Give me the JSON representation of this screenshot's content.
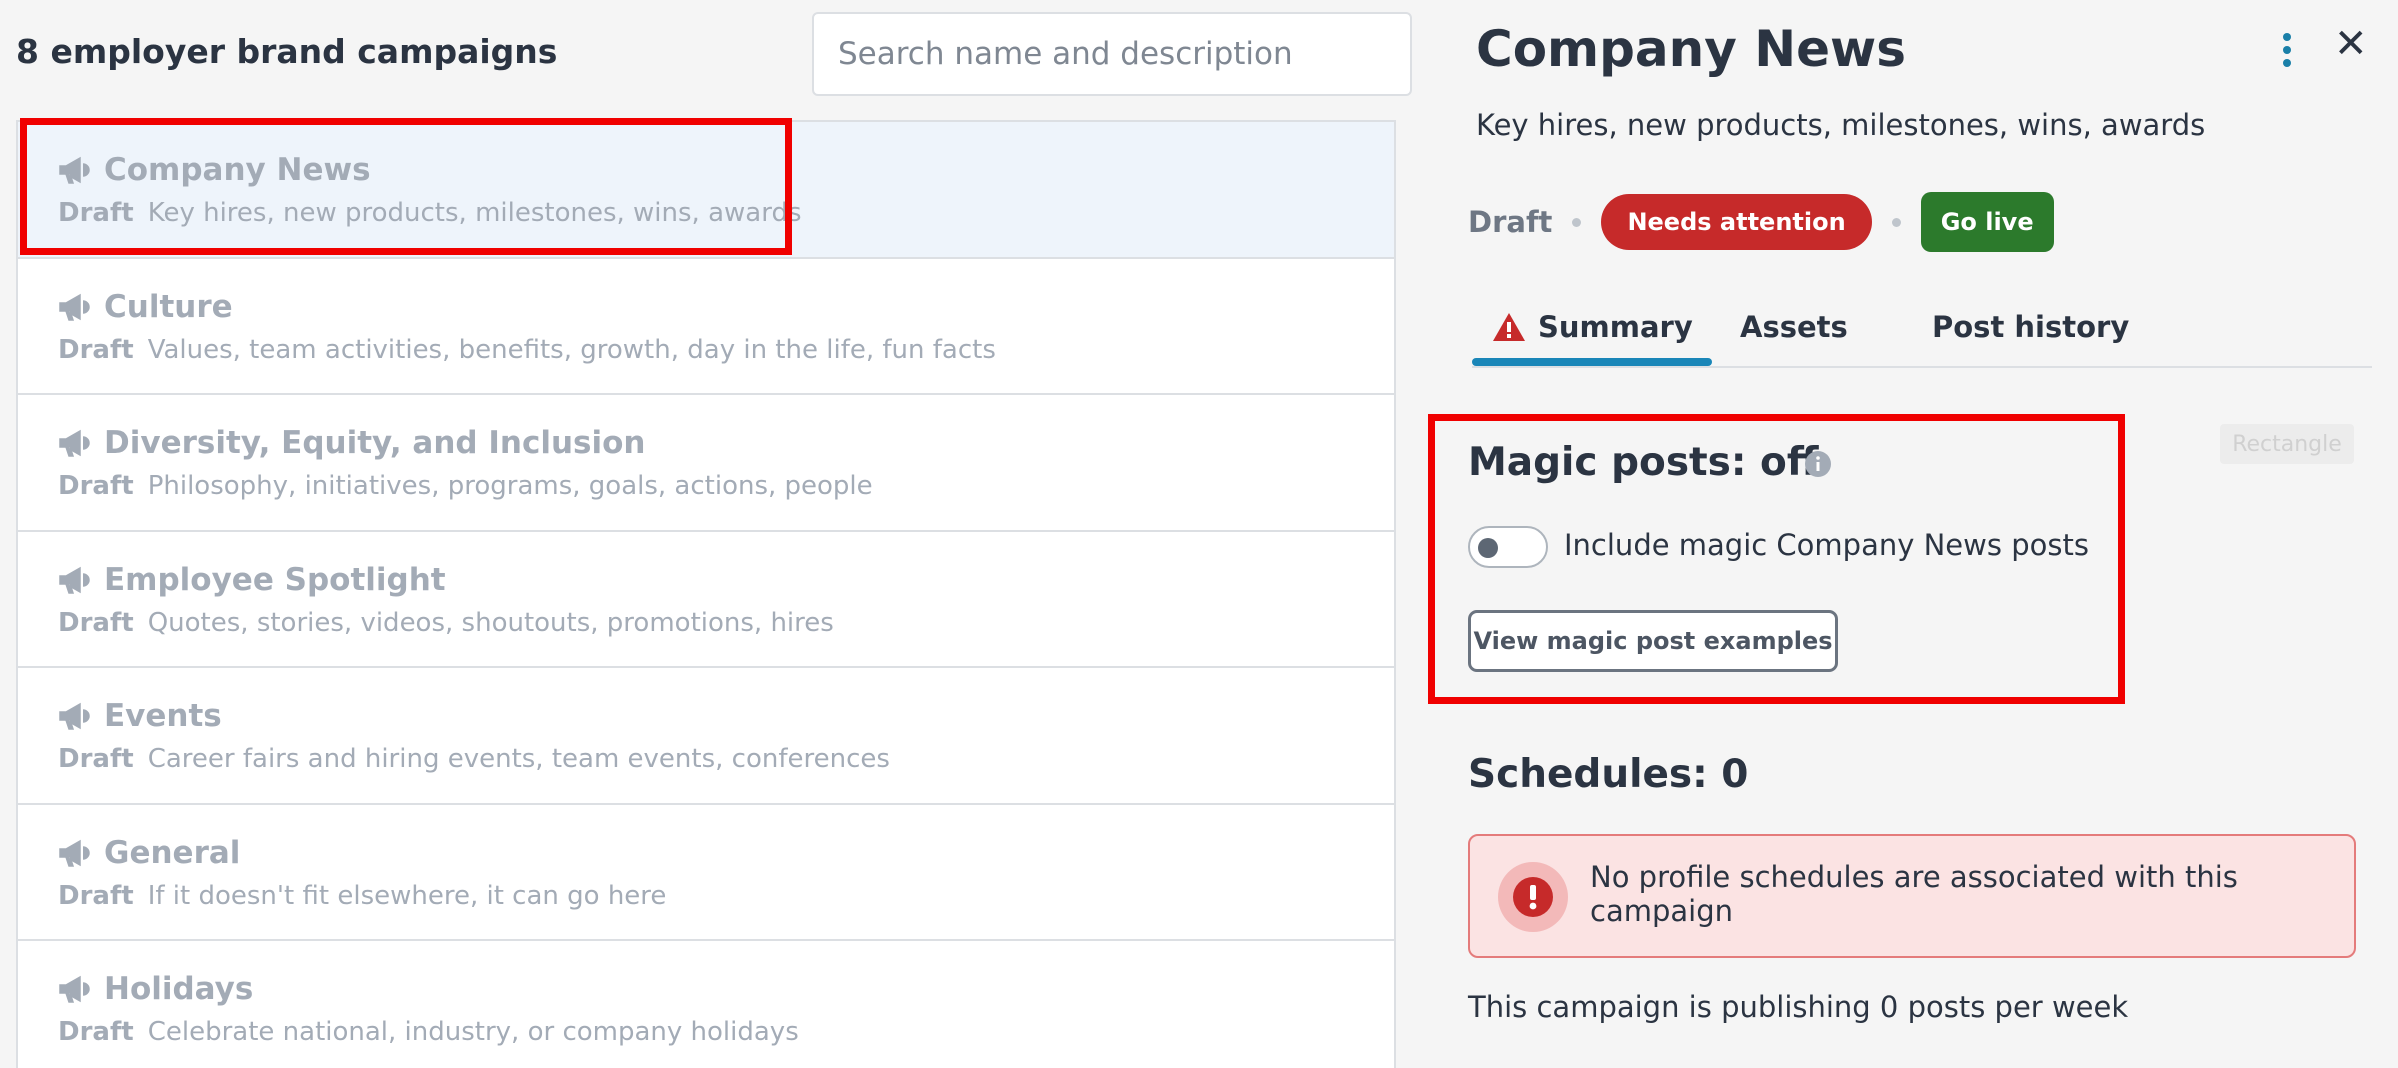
{
  "list": {
    "title": "8 employer brand campaigns",
    "search_placeholder": "Search name and description",
    "items": [
      {
        "name": "Company News",
        "status": "Draft",
        "description": "Key hires, new products, milestones, wins, awards"
      },
      {
        "name": "Culture",
        "status": "Draft",
        "description": "Values, team activities, benefits, growth, day in the life, fun facts"
      },
      {
        "name": "Diversity, Equity, and Inclusion",
        "status": "Draft",
        "description": "Philosophy, initiatives, programs, goals, actions, people"
      },
      {
        "name": "Employee Spotlight",
        "status": "Draft",
        "description": "Quotes, stories, videos, shoutouts, promotions, hires"
      },
      {
        "name": "Events",
        "status": "Draft",
        "description": "Career fairs and hiring events, team events, conferences"
      },
      {
        "name": "General",
        "status": "Draft",
        "description": "If it doesn't fit elsewhere, it can go here"
      },
      {
        "name": "Holidays",
        "status": "Draft",
        "description": "Celebrate national, industry, or company holidays"
      }
    ]
  },
  "detail": {
    "title": "Company News",
    "description": "Key hires, new products, milestones, wins, awards",
    "status": "Draft",
    "needs_attention_label": "Needs attention",
    "go_live_label": "Go live",
    "tabs": [
      {
        "label": "Summary",
        "icon": "warning-icon",
        "active": true
      },
      {
        "label": "Assets"
      },
      {
        "label": "Post history"
      }
    ],
    "rectangle_label": "Rectangle",
    "magic_posts": {
      "title": "Magic posts: off",
      "toggle_label": "Include magic Company News posts",
      "toggle_on": false,
      "examples_button": "View magic post examples"
    },
    "schedules": {
      "title": "Schedules: 0",
      "alert_text": "No profile schedules are associated with this campaign"
    },
    "publish_text": "This campaign is publishing 0 posts per week"
  },
  "colors": {
    "highlight": "#f00000",
    "danger": "#c62a2a",
    "success": "#2c7a2c",
    "accent": "#1a86b8"
  }
}
